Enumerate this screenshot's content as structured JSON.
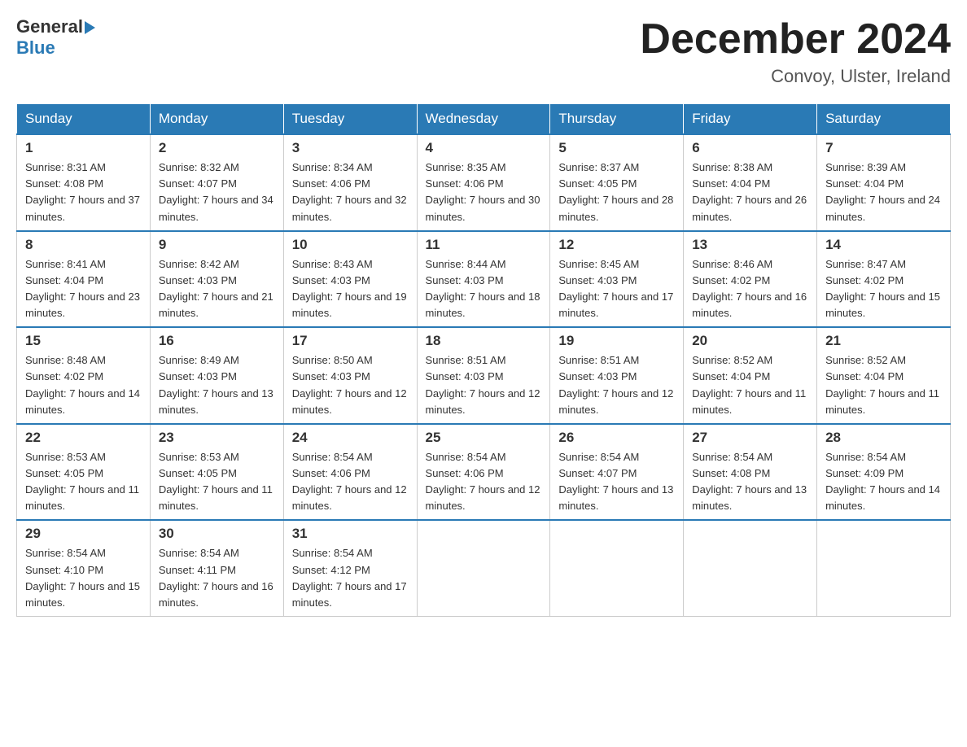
{
  "header": {
    "logo_text_general": "General",
    "logo_text_blue": "Blue",
    "month_title": "December 2024",
    "location": "Convoy, Ulster, Ireland"
  },
  "weekdays": [
    "Sunday",
    "Monday",
    "Tuesday",
    "Wednesday",
    "Thursday",
    "Friday",
    "Saturday"
  ],
  "weeks": [
    [
      {
        "day": "1",
        "sunrise": "8:31 AM",
        "sunset": "4:08 PM",
        "daylight": "7 hours and 37 minutes."
      },
      {
        "day": "2",
        "sunrise": "8:32 AM",
        "sunset": "4:07 PM",
        "daylight": "7 hours and 34 minutes."
      },
      {
        "day": "3",
        "sunrise": "8:34 AM",
        "sunset": "4:06 PM",
        "daylight": "7 hours and 32 minutes."
      },
      {
        "day": "4",
        "sunrise": "8:35 AM",
        "sunset": "4:06 PM",
        "daylight": "7 hours and 30 minutes."
      },
      {
        "day": "5",
        "sunrise": "8:37 AM",
        "sunset": "4:05 PM",
        "daylight": "7 hours and 28 minutes."
      },
      {
        "day": "6",
        "sunrise": "8:38 AM",
        "sunset": "4:04 PM",
        "daylight": "7 hours and 26 minutes."
      },
      {
        "day": "7",
        "sunrise": "8:39 AM",
        "sunset": "4:04 PM",
        "daylight": "7 hours and 24 minutes."
      }
    ],
    [
      {
        "day": "8",
        "sunrise": "8:41 AM",
        "sunset": "4:04 PM",
        "daylight": "7 hours and 23 minutes."
      },
      {
        "day": "9",
        "sunrise": "8:42 AM",
        "sunset": "4:03 PM",
        "daylight": "7 hours and 21 minutes."
      },
      {
        "day": "10",
        "sunrise": "8:43 AM",
        "sunset": "4:03 PM",
        "daylight": "7 hours and 19 minutes."
      },
      {
        "day": "11",
        "sunrise": "8:44 AM",
        "sunset": "4:03 PM",
        "daylight": "7 hours and 18 minutes."
      },
      {
        "day": "12",
        "sunrise": "8:45 AM",
        "sunset": "4:03 PM",
        "daylight": "7 hours and 17 minutes."
      },
      {
        "day": "13",
        "sunrise": "8:46 AM",
        "sunset": "4:02 PM",
        "daylight": "7 hours and 16 minutes."
      },
      {
        "day": "14",
        "sunrise": "8:47 AM",
        "sunset": "4:02 PM",
        "daylight": "7 hours and 15 minutes."
      }
    ],
    [
      {
        "day": "15",
        "sunrise": "8:48 AM",
        "sunset": "4:02 PM",
        "daylight": "7 hours and 14 minutes."
      },
      {
        "day": "16",
        "sunrise": "8:49 AM",
        "sunset": "4:03 PM",
        "daylight": "7 hours and 13 minutes."
      },
      {
        "day": "17",
        "sunrise": "8:50 AM",
        "sunset": "4:03 PM",
        "daylight": "7 hours and 12 minutes."
      },
      {
        "day": "18",
        "sunrise": "8:51 AM",
        "sunset": "4:03 PM",
        "daylight": "7 hours and 12 minutes."
      },
      {
        "day": "19",
        "sunrise": "8:51 AM",
        "sunset": "4:03 PM",
        "daylight": "7 hours and 12 minutes."
      },
      {
        "day": "20",
        "sunrise": "8:52 AM",
        "sunset": "4:04 PM",
        "daylight": "7 hours and 11 minutes."
      },
      {
        "day": "21",
        "sunrise": "8:52 AM",
        "sunset": "4:04 PM",
        "daylight": "7 hours and 11 minutes."
      }
    ],
    [
      {
        "day": "22",
        "sunrise": "8:53 AM",
        "sunset": "4:05 PM",
        "daylight": "7 hours and 11 minutes."
      },
      {
        "day": "23",
        "sunrise": "8:53 AM",
        "sunset": "4:05 PM",
        "daylight": "7 hours and 11 minutes."
      },
      {
        "day": "24",
        "sunrise": "8:54 AM",
        "sunset": "4:06 PM",
        "daylight": "7 hours and 12 minutes."
      },
      {
        "day": "25",
        "sunrise": "8:54 AM",
        "sunset": "4:06 PM",
        "daylight": "7 hours and 12 minutes."
      },
      {
        "day": "26",
        "sunrise": "8:54 AM",
        "sunset": "4:07 PM",
        "daylight": "7 hours and 13 minutes."
      },
      {
        "day": "27",
        "sunrise": "8:54 AM",
        "sunset": "4:08 PM",
        "daylight": "7 hours and 13 minutes."
      },
      {
        "day": "28",
        "sunrise": "8:54 AM",
        "sunset": "4:09 PM",
        "daylight": "7 hours and 14 minutes."
      }
    ],
    [
      {
        "day": "29",
        "sunrise": "8:54 AM",
        "sunset": "4:10 PM",
        "daylight": "7 hours and 15 minutes."
      },
      {
        "day": "30",
        "sunrise": "8:54 AM",
        "sunset": "4:11 PM",
        "daylight": "7 hours and 16 minutes."
      },
      {
        "day": "31",
        "sunrise": "8:54 AM",
        "sunset": "4:12 PM",
        "daylight": "7 hours and 17 minutes."
      },
      null,
      null,
      null,
      null
    ]
  ]
}
